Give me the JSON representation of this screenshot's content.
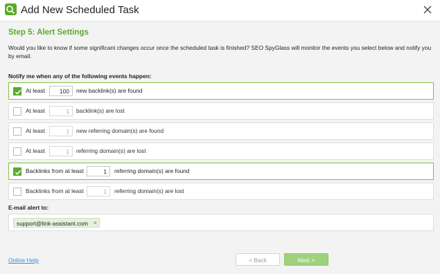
{
  "window": {
    "title": "Add New Scheduled Task",
    "icon": "app-logo-icon",
    "close_icon": "close-icon"
  },
  "step": {
    "title": "Step 5: Alert Settings",
    "description": "Would you like to know if some significant changes occur once the scheduled task is finished? SEO SpyGlass will monitor the events you select below and notify you by email."
  },
  "notify": {
    "label": "Notify me when any of the following events happen:",
    "events": [
      {
        "checked": true,
        "prefix": "At least",
        "value": "100",
        "suffix": "new backlink(s) are found"
      },
      {
        "checked": false,
        "prefix": "At least",
        "value": "1",
        "suffix": "backlink(s) are lost"
      },
      {
        "checked": false,
        "prefix": "At least",
        "value": "1",
        "suffix": "new referring domain(s) are found"
      },
      {
        "checked": false,
        "prefix": "At least",
        "value": "1",
        "suffix": "referring domain(s) are lost"
      },
      {
        "checked": true,
        "prefix": "Backlinks from at least",
        "value": "1",
        "suffix": "referring domain(s) are found"
      },
      {
        "checked": false,
        "prefix": "Backlinks from at least",
        "value": "1",
        "suffix": "referring domain(s) are lost"
      }
    ]
  },
  "email": {
    "label": "E-mail alert to:",
    "recipients": [
      "support@link-assistant.com"
    ],
    "remove_symbol": "×"
  },
  "footer": {
    "help_link": "Online Help",
    "back_label": "< Back",
    "next_label": "Next >"
  },
  "colors": {
    "accent": "#5aaa2a",
    "selected_border": "#7cc04a",
    "link": "#3a8ed8"
  }
}
